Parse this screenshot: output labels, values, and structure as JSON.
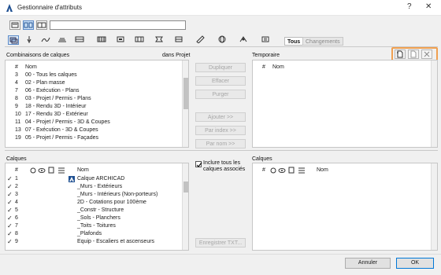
{
  "window": {
    "title": "Gestionnaire d'attributs",
    "help_label": "?",
    "close_label": "✕"
  },
  "search": {
    "value": "",
    "placeholder": ""
  },
  "filter_tabs": {
    "all": "Tous",
    "changes": "Changements"
  },
  "left_top": {
    "title": "Combinaisons de calques",
    "source_label": "dans Projet",
    "col_num": "#",
    "col_name": "Nom",
    "rows": [
      {
        "num": "3",
        "name": "00 - Tous les calques"
      },
      {
        "num": "4",
        "name": "02 - Plan masse"
      },
      {
        "num": "7",
        "name": "06 - Exécution - Plans"
      },
      {
        "num": "8",
        "name": "03 - Projet / Permis - Plans"
      },
      {
        "num": "9",
        "name": "18 - Rendu 3D - Intérieur"
      },
      {
        "num": "10",
        "name": "17 - Rendu 3D - Extérieur"
      },
      {
        "num": "11",
        "name": "04 - Projet / Permis - 3D & Coupes"
      },
      {
        "num": "13",
        "name": "07 - Exécution - 3D & Coupes"
      },
      {
        "num": "19",
        "name": "05 - Projet / Permis - Façades"
      }
    ]
  },
  "mid_buttons": {
    "duplicate": "Dupliquer",
    "delete": "Effacer",
    "purge": "Purger",
    "add": "Ajouter >>",
    "by_index": "Par index >>",
    "by_name": "Par nom >>",
    "include_text": "Inclure tous les calques associés",
    "save_txt": "Enregistrer TXT..."
  },
  "right_top": {
    "title": "Temporaire",
    "col_num": "#",
    "col_name": "Nom"
  },
  "left_bottom": {
    "title": "Calques",
    "col_num": "#",
    "col_name": "Nom",
    "rows": [
      {
        "num": "1",
        "name": "Calque ARCHICAD"
      },
      {
        "num": "2",
        "name": "_Murs - Extérieurs"
      },
      {
        "num": "3",
        "name": "_Murs - Intérieurs (Non-porteurs)"
      },
      {
        "num": "4",
        "name": "2D - Cotations pour 100ème"
      },
      {
        "num": "5",
        "name": "_Constr - Structure"
      },
      {
        "num": "6",
        "name": "_Sols - Planchers"
      },
      {
        "num": "7",
        "name": "_Toits - Toitures"
      },
      {
        "num": "8",
        "name": "_Plafonds"
      },
      {
        "num": "9",
        "name": "Equip - Escaliers et ascenseurs"
      }
    ]
  },
  "right_bottom": {
    "title": "Calques",
    "col_num": "#",
    "col_name": "Nom"
  },
  "footer": {
    "cancel": "Annuler",
    "ok": "OK"
  },
  "colors": {
    "highlight_box": "#f0a050",
    "default_button_border": "#0078d7"
  }
}
